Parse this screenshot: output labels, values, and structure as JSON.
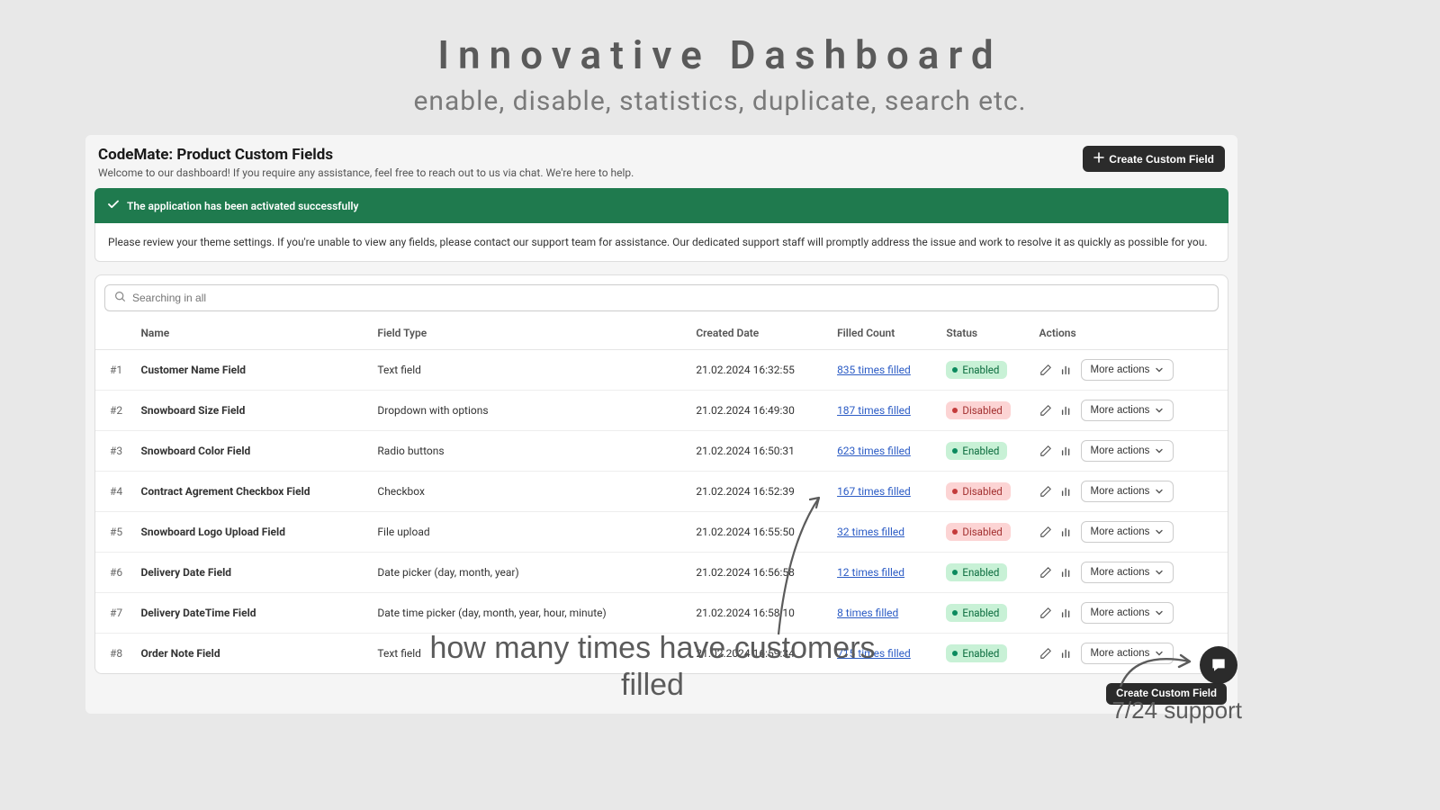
{
  "marketing": {
    "title": "Innovative Dashboard",
    "subtitle": "enable, disable, statistics, duplicate, search etc."
  },
  "header": {
    "title": "CodeMate: Product Custom Fields",
    "welcome": "Welcome to our dashboard! If you require any assistance, feel free to reach out to us via chat. We're here to help.",
    "create_label": "Create Custom Field"
  },
  "alert": {
    "success": "The application has been activated successfully",
    "body": "Please review your theme settings. If you're unable to view any fields, please contact our support team for assistance. Our dedicated support staff will promptly address the issue and work to resolve it as quickly as possible for you."
  },
  "search": {
    "placeholder": "Searching in all"
  },
  "columns": {
    "name": "Name",
    "type": "Field Type",
    "date": "Created Date",
    "filled": "Filled Count",
    "status": "Status",
    "actions": "Actions"
  },
  "status_labels": {
    "enabled": "Enabled",
    "disabled": "Disabled"
  },
  "actions_labels": {
    "more": "More actions"
  },
  "rows": [
    {
      "idx": "#1",
      "name": "Customer Name Field",
      "type": "Text field",
      "date": "21.02.2024 16:32:55",
      "filled": "835 times filled",
      "status": "enabled"
    },
    {
      "idx": "#2",
      "name": "Snowboard Size Field",
      "type": "Dropdown with options",
      "date": "21.02.2024 16:49:30",
      "filled": "187 times filled",
      "status": "disabled"
    },
    {
      "idx": "#3",
      "name": "Snowboard Color Field",
      "type": "Radio buttons",
      "date": "21.02.2024 16:50:31",
      "filled": "623 times filled",
      "status": "enabled"
    },
    {
      "idx": "#4",
      "name": "Contract Agrement Checkbox Field",
      "type": "Checkbox",
      "date": "21.02.2024 16:52:39",
      "filled": "167 times filled",
      "status": "disabled"
    },
    {
      "idx": "#5",
      "name": "Snowboard Logo Upload Field",
      "type": "File upload",
      "date": "21.02.2024 16:55:50",
      "filled": "32 times filled",
      "status": "disabled"
    },
    {
      "idx": "#6",
      "name": "Delivery Date Field",
      "type": "Date picker (day, month, year)",
      "date": "21.02.2024 16:56:58",
      "filled": "12 times filled",
      "status": "enabled"
    },
    {
      "idx": "#7",
      "name": "Delivery DateTime Field",
      "type": "Date time picker (day, month, year, hour, minute)",
      "date": "21.02.2024 16:58:10",
      "filled": "8 times filled",
      "status": "enabled"
    },
    {
      "idx": "#8",
      "name": "Order Note Field",
      "type": "Text field",
      "date": "21.02.2024 16:59:34",
      "filled": "715 times filled",
      "status": "enabled"
    }
  ],
  "footer": {
    "create_label": "Create Custom Field"
  },
  "annotations": {
    "filled_note": "how many times have customers filled",
    "support_note": "7/24 support"
  }
}
